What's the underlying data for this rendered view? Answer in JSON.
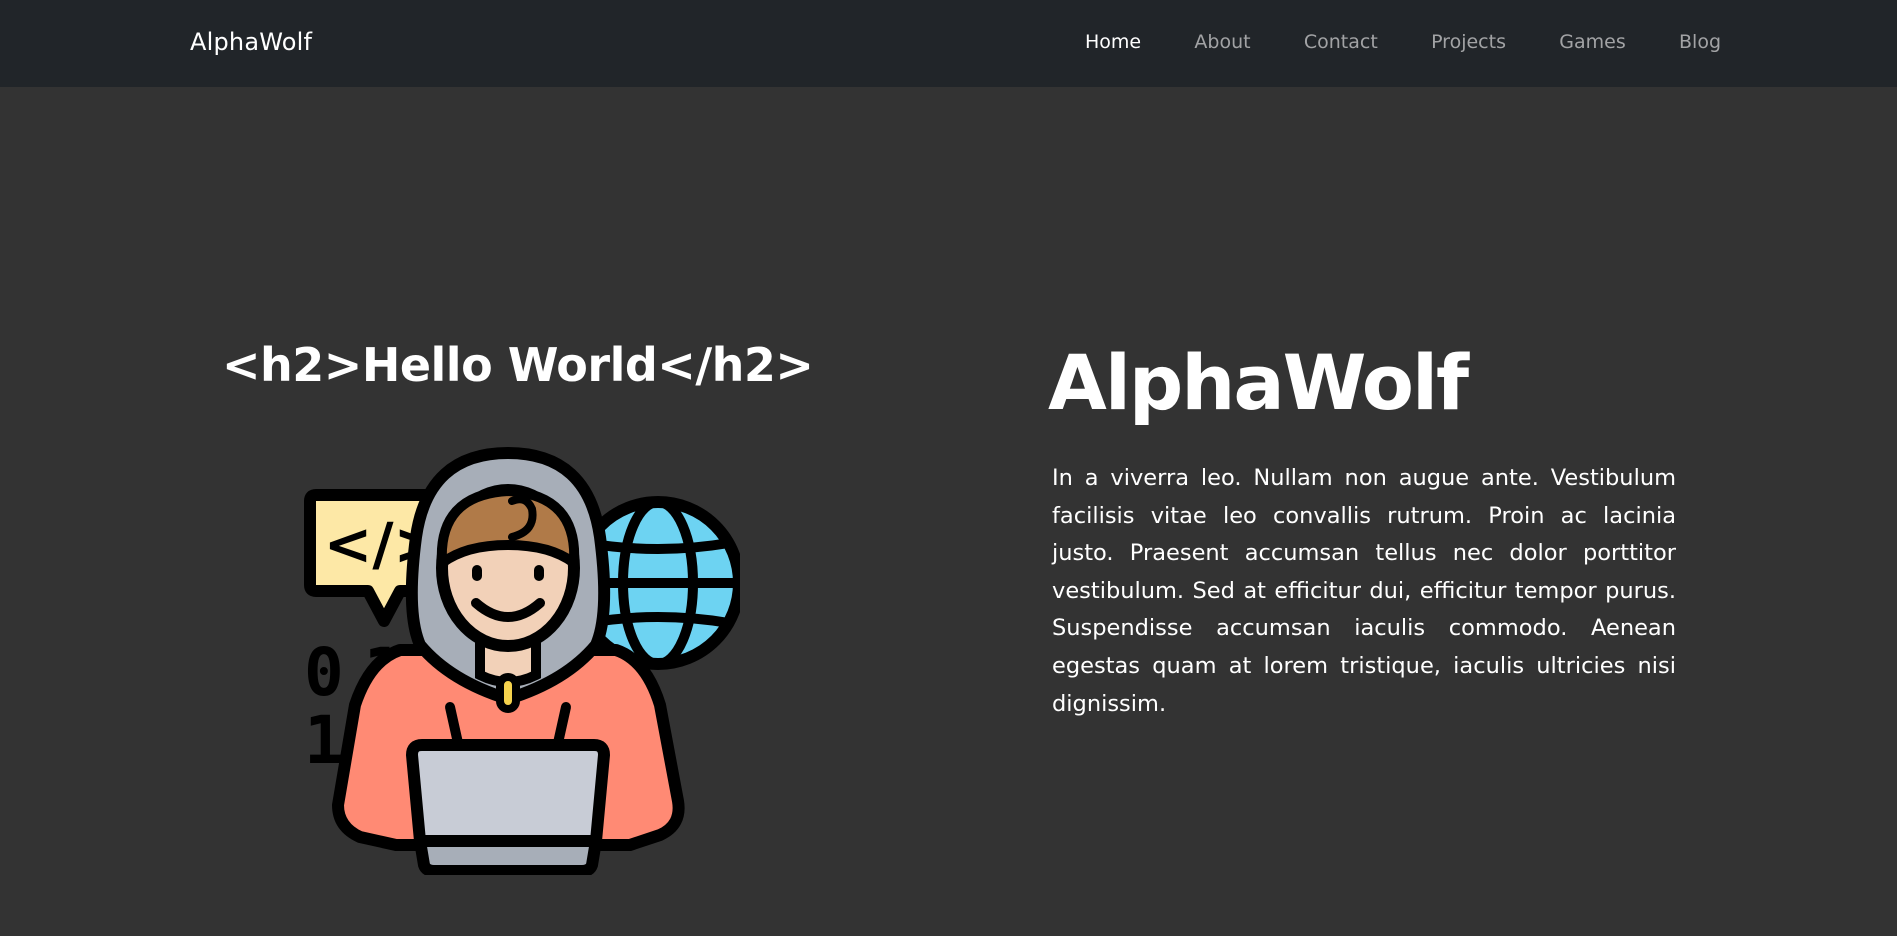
{
  "navbar": {
    "brand": "AlphaWolf",
    "links": [
      {
        "label": "Home",
        "active": true
      },
      {
        "label": "About"
      },
      {
        "label": "Contact"
      },
      {
        "label": "Projects"
      },
      {
        "label": "Games"
      },
      {
        "label": "Blog"
      }
    ]
  },
  "hero": {
    "typed_text": "<h2>Hello World</h2>",
    "illustration": {
      "bubble_text": "</>",
      "binary_rows": [
        "0 1 0",
        "1 0"
      ]
    },
    "title": "AlphaWolf",
    "paragraph": "In a viverra leo. Nullam non augue ante. Vestibulum facilisis vitae leo convallis rutrum. Proin ac lacinia justo. Praesent accumsan tellus nec dolor porttitor vestibulum. Sed at efficitur dui, efficitur tempor purus. Suspendisse accumsan iaculis commodo. Aenean egestas quam at lorem tristique, iaculis ultricies nisi dignissim."
  },
  "colors": {
    "navbar_bg": "#212529",
    "page_bg": "#333333",
    "nav_link": "#a2a3a5",
    "nav_link_active": "#ffffff",
    "speech_bubble": "#fde8a6",
    "globe": "#6dd3f2",
    "hoodie": "#a7aeb8",
    "hair": "#b07a48",
    "skin": "#f2d1b8",
    "sweater": "#ff8a74",
    "laptop": "#c8ccd6"
  }
}
